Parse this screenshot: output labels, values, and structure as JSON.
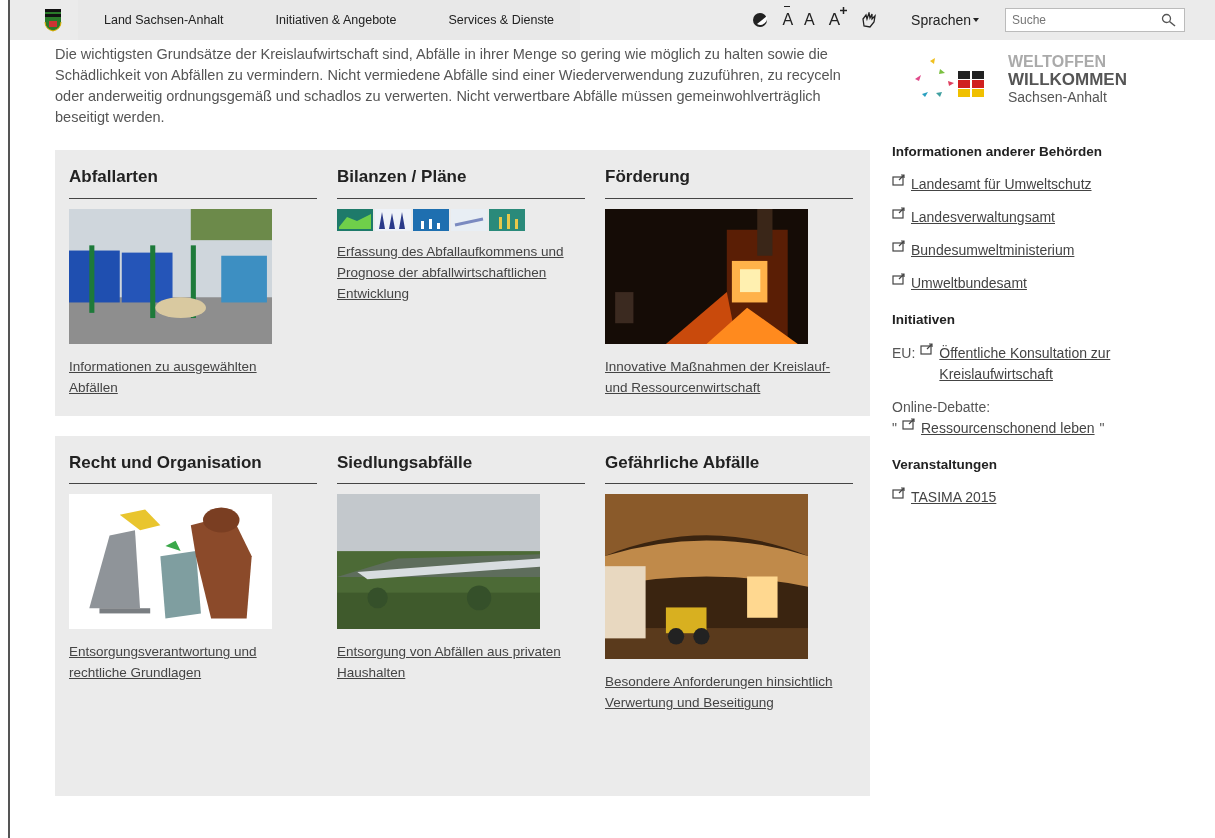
{
  "navbar": {
    "items": [
      {
        "label": "Land Sachsen-Anhalt"
      },
      {
        "label": "Initiativen & Angebote"
      },
      {
        "label": "Services & Dienste"
      }
    ],
    "font_tools": [
      {
        "kind": "smaller",
        "label": "A"
      },
      {
        "kind": "normal",
        "label": "A"
      },
      {
        "kind": "larger",
        "label": "A"
      }
    ],
    "languages": "Sprachen",
    "search": {
      "placeholder": "Suche"
    }
  },
  "intro": "Die wichtigsten Grundsätze der Kreislaufwirtschaft sind, Abfälle in ihrer Menge so gering wie möglich zu halten sowie die Schädlichkeit von Abfällen zu vermindern. Nicht vermiedene Abfälle sind einer Wiederverwendung zuzuführen, zu recyceln oder anderweitig ordnungsgemäß und schadlos zu verwerten. Nicht verwertbare Abfälle müssen gemeinwohlverträglich beseitigt werden.",
  "badge": {
    "line_1": "WELTOFFEN",
    "line_2": "WILLKOMMEN",
    "line_3": "Sachsen-Anhalt"
  },
  "panels": [
    [
      {
        "title": "Abfallarten",
        "kind": "picture",
        "link": "Informationen zu ausgewählten Abfällen"
      },
      {
        "title": "Bilanzen / Pläne",
        "kind": "thumbnails",
        "link": "Erfassung des Abfallaufkommens und Prognose der abfallwirtschaftlichen Entwicklung"
      },
      {
        "title": "Förderung",
        "kind": "picture",
        "link": "Innovative Maßnahmen der Kreislauf- und Ressourcenwirtschaft"
      }
    ],
    [
      {
        "title": "Recht und Organisation",
        "kind": "picture",
        "link": "Entsorgungsverantwortung und rechtliche Grundlagen"
      },
      {
        "title": "Siedlungsabfälle",
        "kind": "picture",
        "link": "Entsorgung von Abfällen aus privaten Haushalten"
      },
      {
        "title": "Gefährliche Abfälle",
        "kind": "picture",
        "link": "Besondere Anforderungen hinsichtlich Verwertung und Beseitigung"
      }
    ]
  ],
  "sidebar": [
    {
      "heading": "Informationen anderer Behörden",
      "items": [
        {
          "link": "Landesamt für Umweltschutz"
        },
        {
          "link": "Landesverwaltungsamt"
        },
        {
          "link": "Bundesumweltministerium"
        },
        {
          "link": "Umweltbundesamt"
        }
      ]
    },
    {
      "heading": "Initiativen",
      "items": [
        {
          "prefix": "EU:",
          "link": "Öffentliche Konsultation zur Kreislaufwirtschaft"
        },
        {
          "prefix": "Online-Debatte:",
          "open": "\"",
          "link": "Ressourcenschonend leben",
          "close": "\""
        }
      ]
    },
    {
      "heading": "Veranstaltungen",
      "items": [
        {
          "link": "TASIMA 2015"
        }
      ]
    }
  ]
}
